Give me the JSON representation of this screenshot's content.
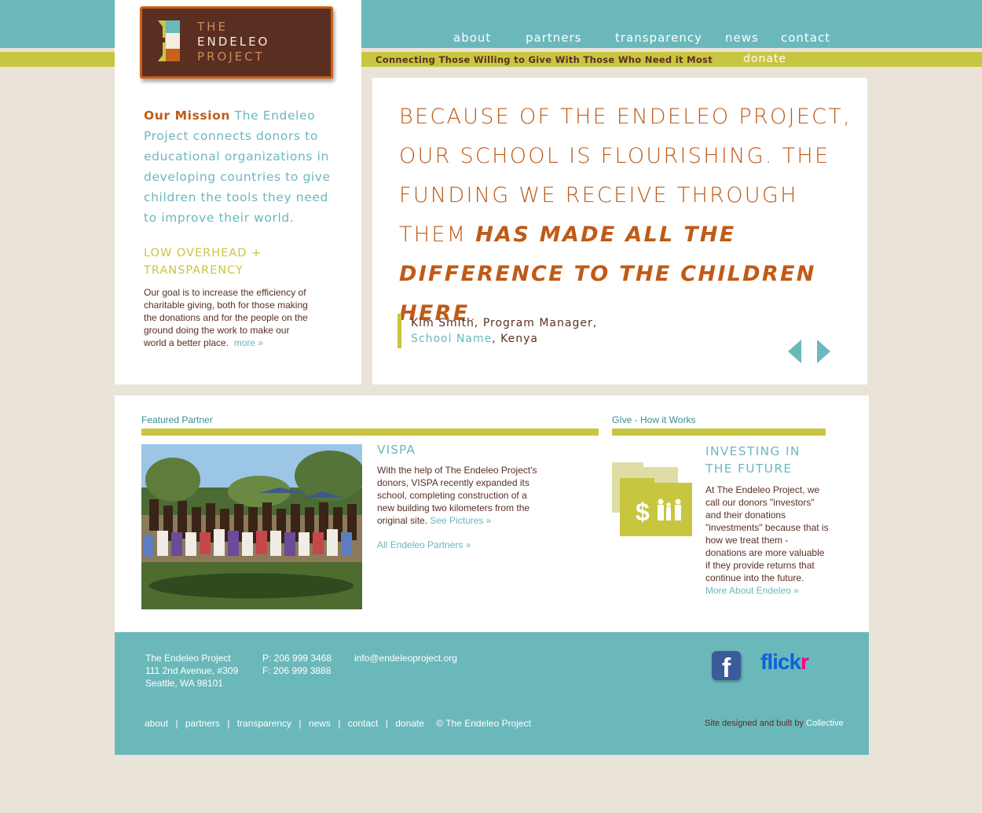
{
  "logo": {
    "line1": "THE",
    "line2": "ENDELEO",
    "line3": "PROJECT"
  },
  "nav": {
    "about": "about",
    "partners": "partners",
    "transparency": "transparency",
    "news": "news",
    "contact": "contact",
    "donate": "donate"
  },
  "tagline": "Connecting Those Willing to Give With Those Who Need it Most",
  "mission": {
    "lead": "Our Mission",
    "text": " The Endeleo Project connects donors to educational organizations in developing countries to give children the tools they need to improve their world."
  },
  "overhead": {
    "heading": "LOW OVERHEAD + TRANSPARENCY",
    "text": "Our goal is to increase the efficiency of charitable giving, both for those making the donations and for the people on the ground doing the work to make our world a better place.",
    "more": "more »"
  },
  "quote": {
    "part1": "BECAUSE OF THE ENDELEO PROJECT, OUR  SCHOOL IS FLOURISHING. THE FUNDING WE RECEIVE THROUGH THEM ",
    "emphasis": "HAS MADE ALL THE DIFFERENCE TO THE CHILDREN HERE",
    "end": "."
  },
  "attribution": {
    "name": "Kim Smith, Program Manager,",
    "school": "School Name",
    "country": ", Kenya"
  },
  "featured": {
    "label": "Featured Partner",
    "title": "VISPA",
    "text": "With the help of The Endeleo Project's donors, VISPA recently expanded its school, completing construction of a new building two kilometers from the original site.",
    "pictures": "See Pictures »",
    "all": "All Endeleo Partners »"
  },
  "give": {
    "label": "GIve - How it Works",
    "heading": "INVESTING IN THE FUTURE",
    "text": "At The Endeleo Project, we call our donors \"investors\" and their donations \"investments\" because that is how we treat them - donations are more valuable if they provide returns that continue into the future.",
    "more": "More About Endeleo »",
    "icon_symbol": "$"
  },
  "footer": {
    "org": "The Endeleo Project",
    "street": "111 2nd Avenue, #309",
    "city": "Seattle, WA 98101",
    "phone": "P: 206 999 3468",
    "fax": "F: 206 999 3888",
    "email": "info@endeleoproject.org",
    "nav": [
      "about",
      "|",
      "partners",
      "|",
      "transparency",
      "|",
      "news",
      "|",
      "contact",
      "|",
      "donate"
    ],
    "copyright": "© The Endeleo Project",
    "credit_prefix": "Site designed and built by",
    "credit_name": "Collective",
    "facebook": "f",
    "flickr_a": "flick",
    "flickr_b": "r"
  }
}
